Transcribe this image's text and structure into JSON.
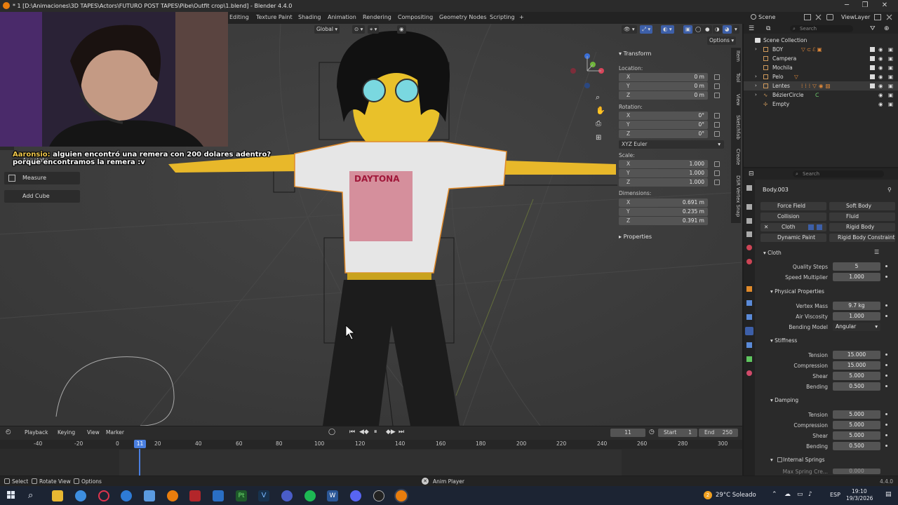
{
  "window": {
    "title": "* 1 [D:\\Animaciones\\3D TAPES\\Actors\\FUTURO POST TAPES\\Pibe\\Outfit crop\\1.blend] - Blender 4.4.0",
    "minimize": "─",
    "restore": "❐",
    "close": "✕"
  },
  "menubar": {
    "tabs": [
      "Editing",
      "Texture Paint",
      "Shading",
      "Animation",
      "Rendering",
      "Compositing",
      "Geometry Nodes",
      "Scripting",
      "+"
    ],
    "scene": "Scene",
    "view_layer": "ViewLayer"
  },
  "viewport_header": {
    "orientation": "Global",
    "options": "Options"
  },
  "tools": {
    "annotate": "Annotate",
    "measure": "Measure",
    "add_cube": "Add Cube"
  },
  "chat": {
    "user": "Aaronsio:",
    "message": "alguien encontró una remera con 200 dolares adentro? porque encontramos la remera :v"
  },
  "npanel": {
    "tabs": [
      "Item",
      "Tool",
      "View",
      "Sketchfab",
      "Create",
      "DSR Vertex Snap"
    ],
    "transform_title": "Transform",
    "location_label": "Location:",
    "location": [
      {
        "axis": "X",
        "value": "0 m"
      },
      {
        "axis": "Y",
        "value": "0 m"
      },
      {
        "axis": "Z",
        "value": "0 m"
      }
    ],
    "rotation_label": "Rotation:",
    "rotation": [
      {
        "axis": "X",
        "value": "0°"
      },
      {
        "axis": "Y",
        "value": "0°"
      },
      {
        "axis": "Z",
        "value": "0°"
      }
    ],
    "rotation_mode": "XYZ Euler",
    "scale_label": "Scale:",
    "scale": [
      {
        "axis": "X",
        "value": "1.000"
      },
      {
        "axis": "Y",
        "value": "1.000"
      },
      {
        "axis": "Z",
        "value": "1.000"
      }
    ],
    "dimensions_label": "Dimensions:",
    "dimensions": [
      {
        "axis": "X",
        "value": "0.691 m"
      },
      {
        "axis": "Y",
        "value": "0.235 m"
      },
      {
        "axis": "Z",
        "value": "0.391 m"
      }
    ],
    "properties_title": "Properties"
  },
  "outliner": {
    "search_placeholder": "Search",
    "root": "Scene Collection",
    "items": [
      {
        "name": "BOY"
      },
      {
        "name": "Campera"
      },
      {
        "name": "Mochila"
      },
      {
        "name": "Pelo"
      },
      {
        "name": "Lentes"
      },
      {
        "name": "BézierCircle"
      },
      {
        "name": "Empty"
      }
    ]
  },
  "properties": {
    "search_placeholder": "Search",
    "object_name": "Body.003",
    "physics_buttons": [
      [
        "Force Field",
        "Soft Body"
      ],
      [
        "Collision",
        "Fluid"
      ],
      [
        "Cloth",
        "Rigid Body"
      ],
      [
        "Dynamic Paint",
        "Rigid Body Constraint"
      ]
    ],
    "cloth_title": "Cloth",
    "quality_steps_label": "Quality Steps",
    "quality_steps": "5",
    "speed_multiplier_label": "Speed Multiplier",
    "speed_multiplier": "1.000",
    "physical_props_title": "Physical Properties",
    "vertex_mass_label": "Vertex Mass",
    "vertex_mass": "9.7 kg",
    "air_viscosity_label": "Air Viscosity",
    "air_viscosity": "1.000",
    "bending_model_label": "Bending Model",
    "bending_model": "Angular",
    "stiffness_title": "Stiffness",
    "stiffness": [
      {
        "label": "Tension",
        "value": "15.000"
      },
      {
        "label": "Compression",
        "value": "15.000"
      },
      {
        "label": "Shear",
        "value": "5.000"
      },
      {
        "label": "Bending",
        "value": "0.500"
      }
    ],
    "damping_title": "Damping",
    "damping": [
      {
        "label": "Tension",
        "value": "5.000"
      },
      {
        "label": "Compression",
        "value": "5.000"
      },
      {
        "label": "Shear",
        "value": "5.000"
      },
      {
        "label": "Bending",
        "value": "0.500"
      }
    ],
    "internal_springs_title": "Internal Springs",
    "max_spring_label": "Max Spring Cre...",
    "max_spring_value": "0.000"
  },
  "timeline": {
    "menus": [
      "Playback",
      "Keying",
      "View",
      "Marker"
    ],
    "current_frame": "11",
    "start_label": "Start",
    "start": "1",
    "end_label": "End",
    "end": "250",
    "ticks": [
      "-40",
      "-20",
      "0",
      "20",
      "40",
      "60",
      "80",
      "100",
      "120",
      "140",
      "160",
      "180",
      "200",
      "220",
      "240",
      "260",
      "280",
      "300"
    ]
  },
  "statusbar": {
    "select": "Select",
    "rotate_view": "Rotate View",
    "options": "Options",
    "anim_player": "Anim Player",
    "version": "4.4.0"
  },
  "taskbar": {
    "weather_badge": "2",
    "weather": "29°C Soleado",
    "language": "ESP",
    "time": "19:10",
    "date": "19/3/2026"
  }
}
